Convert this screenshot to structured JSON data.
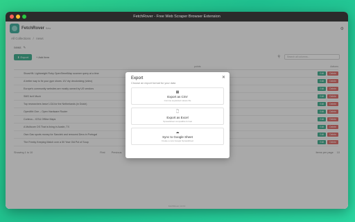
{
  "window": {
    "title": "FetchRover - Free Web Scraper Browser Extension"
  },
  "header": {
    "brand": "FetchRover",
    "badge": "Beta"
  },
  "breadcrumb": {
    "parent": "All Collections",
    "current": "news"
  },
  "list": {
    "name": "news"
  },
  "toolbar": {
    "export_label": "Export",
    "add_label": "Add item",
    "search_placeholder": "Search all columns..."
  },
  "table": {
    "headers": [
      "",
      "",
      "points",
      "Actions"
    ],
    "rows": [
      {
        "title": "ShowHN: Lightweight Ruby OpenStreetMap scanner query at a time",
        "points": "109 points"
      },
      {
        "title": "A better way to fix your gym shoes: UV dry deodorizing (video)",
        "points": "137 points"
      },
      {
        "title": "Europe's community websites are mostly owned by US vendors",
        "points": "195 points"
      },
      {
        "title": "SMS Isn't Much",
        "points": "152 points"
      },
      {
        "title": "Top researchers leave LGA for the Netherlands (in Dutch)",
        "points": "486 points"
      },
      {
        "title": "OpenWrt One – Open Hardware Router",
        "points": "731 points"
      },
      {
        "title": "Cortexa – ICSU Offline Maps",
        "points": "376 points"
      },
      {
        "title": "A Multicore OS That is living in Austin, TX",
        "points": ""
      },
      {
        "title": "Owo Gas sports money for Sanctek and removed Devs in Portugal",
        "points": "50 points"
      },
      {
        "title": "The Freeky Keeping Match over a 50 Year Old Pot of Soup",
        "points": "19 points"
      }
    ],
    "edit_label": "Edit",
    "delete_label": "Delete"
  },
  "pager": {
    "info": "Showing 1 to 10",
    "first": "First",
    "prev": "Previous",
    "p1": "1",
    "p2": "2",
    "p3": "3",
    "ellipsis": "...",
    "p9": "9",
    "next": "Next",
    "last": "Last",
    "perpage": "Items per page",
    "perpage_value": "10"
  },
  "footer": {
    "text": "FetchRover v1.0.0"
  },
  "modal": {
    "title": "Export",
    "subtitle": "Choose an export format for your data",
    "options": [
      {
        "label": "Export as CSV",
        "desc": "Comma separated values file"
      },
      {
        "label": "Export as Excel",
        "desc": "Spreadsheet compatible format"
      },
      {
        "label": "Sync to Google Sheet",
        "desc": "Create a new Google Spreadsheet"
      }
    ]
  }
}
